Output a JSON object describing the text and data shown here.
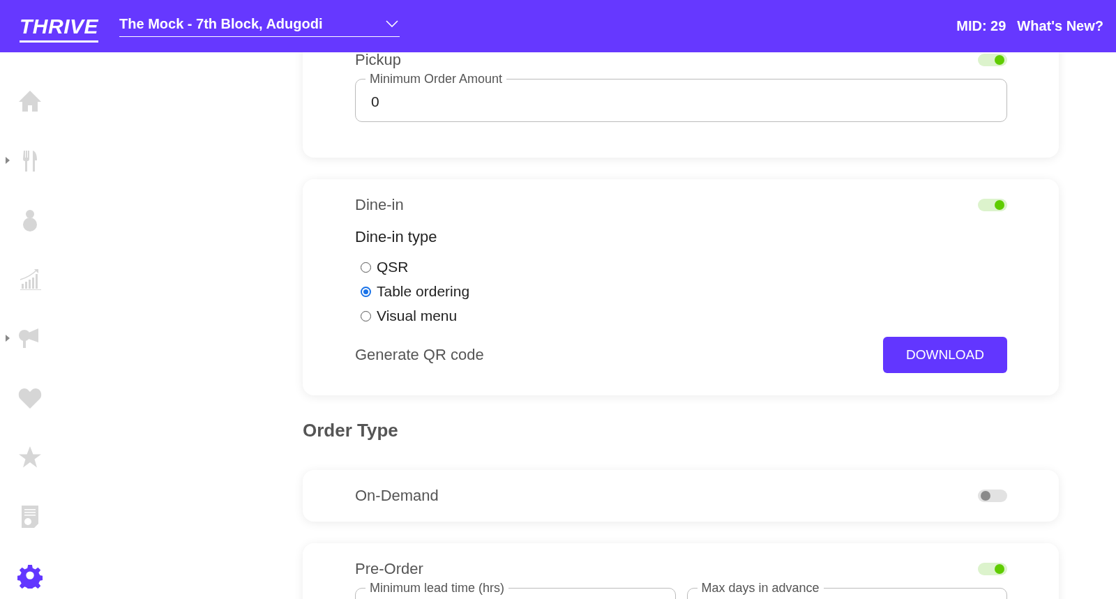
{
  "header": {
    "logo": "THRIVE",
    "location": "The Mock - 7th Block, Adugodi",
    "mid": "MID: 29",
    "whats_new": "What's New?"
  },
  "sidebar": {
    "items": [
      {
        "expandable": false,
        "selected": false
      },
      {
        "expandable": true,
        "selected": false
      },
      {
        "expandable": false,
        "selected": false
      },
      {
        "expandable": false,
        "selected": false
      },
      {
        "expandable": true,
        "selected": false
      },
      {
        "expandable": false,
        "selected": false
      },
      {
        "expandable": false,
        "selected": false
      },
      {
        "expandable": false,
        "selected": false
      },
      {
        "expandable": false,
        "selected": true
      }
    ]
  },
  "sections": [
    {
      "kind": "fields",
      "title": "Pickup",
      "enabled": true,
      "fields": [
        {
          "label": "Minimum Order Amount",
          "value": "0"
        }
      ]
    },
    {
      "kind": "dine_in",
      "title": "Dine-in",
      "enabled": true,
      "type_label": "Dine-in type",
      "options": [
        {
          "label": "QSR",
          "selected": false
        },
        {
          "label": "Table ordering",
          "selected": true
        },
        {
          "label": "Visual menu",
          "selected": false
        }
      ],
      "qr_label": "Generate QR code",
      "button": "DOWNLOAD"
    },
    {
      "kind": "heading",
      "text": "Order Type"
    },
    {
      "kind": "toggle",
      "title": "On-Demand",
      "enabled": false
    },
    {
      "kind": "fields",
      "title": "Pre-Order",
      "enabled": true,
      "fields": [
        {
          "label": "Minimum lead time (hrs)"
        },
        {
          "label": "Max days in advance"
        }
      ]
    }
  ]
}
